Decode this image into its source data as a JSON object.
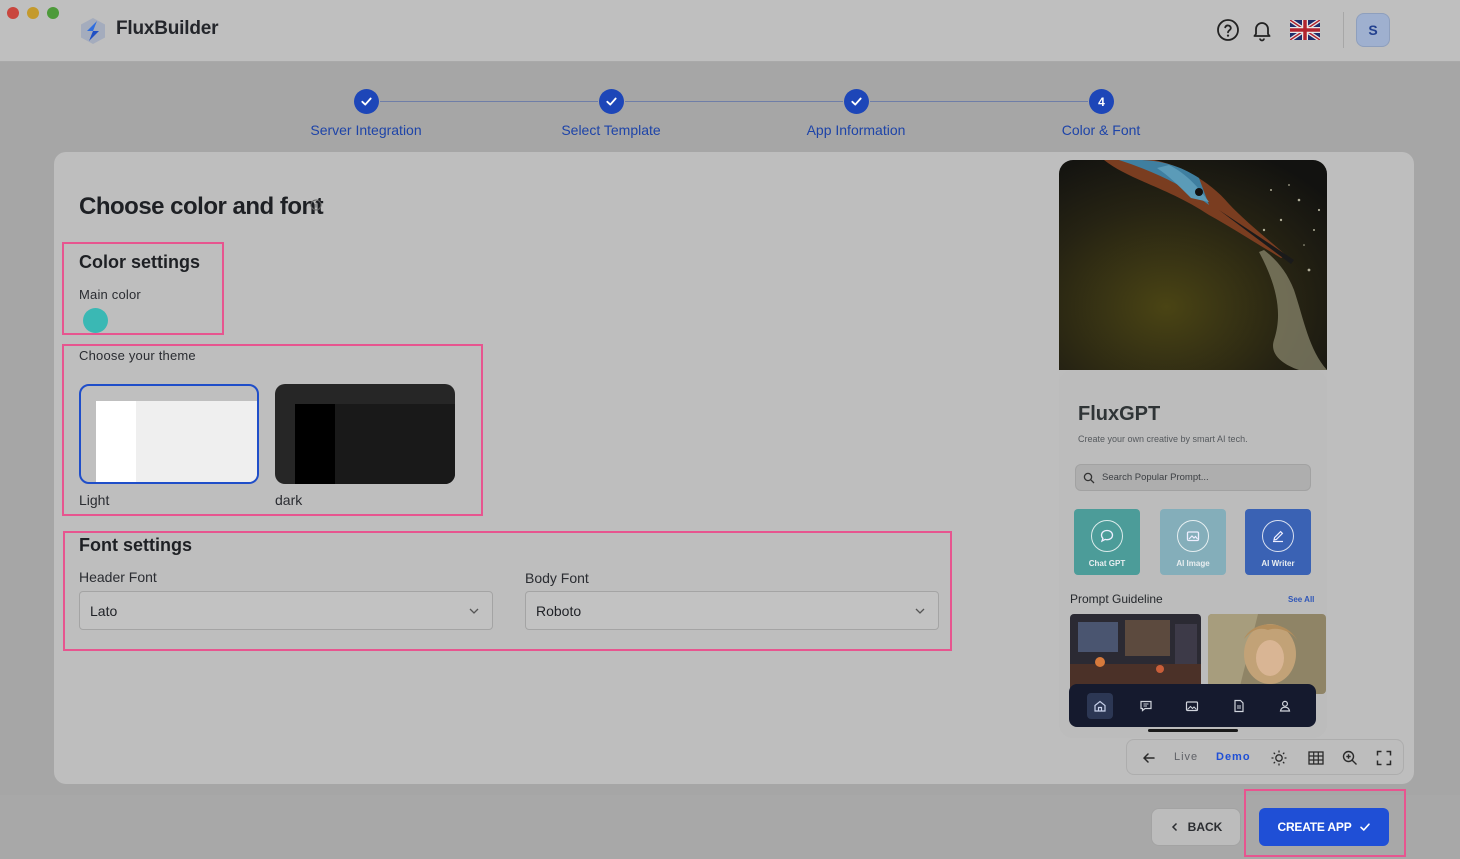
{
  "app": {
    "brand": "FluxBuilder",
    "avatar_initial": "S"
  },
  "stepper": {
    "steps": [
      {
        "label": "Server Integration",
        "state": "done"
      },
      {
        "label": "Select Template",
        "state": "done"
      },
      {
        "label": "App Information",
        "state": "done"
      },
      {
        "label": "Color & Font",
        "number": "4",
        "state": "current"
      }
    ]
  },
  "page": {
    "title": "Choose color and font"
  },
  "color_settings": {
    "heading": "Color settings",
    "main_color_label": "Main color",
    "main_color": "#3ab8b4"
  },
  "theme": {
    "label": "Choose your theme",
    "options": [
      {
        "label": "Light",
        "selected": true
      },
      {
        "label": "dark",
        "selected": false
      }
    ]
  },
  "font_settings": {
    "heading": "Font settings",
    "header_font_label": "Header Font",
    "header_font_value": "Lato",
    "body_font_label": "Body Font",
    "body_font_value": "Roboto"
  },
  "preview": {
    "app_title": "FluxGPT",
    "app_subtitle": "Create your own creative by smart AI tech.",
    "search_placeholder": "Search Popular Prompt...",
    "features": [
      "Chat GPT",
      "AI Image",
      "AI Writer"
    ],
    "section_title": "Prompt Guideline",
    "see_all": "See All",
    "toolbar": {
      "live": "Live",
      "demo": "Demo"
    }
  },
  "footer": {
    "back_label": "BACK",
    "create_label": "CREATE APP"
  },
  "colors": {
    "accent": "#1f4fd6",
    "highlight": "#e7558f"
  }
}
